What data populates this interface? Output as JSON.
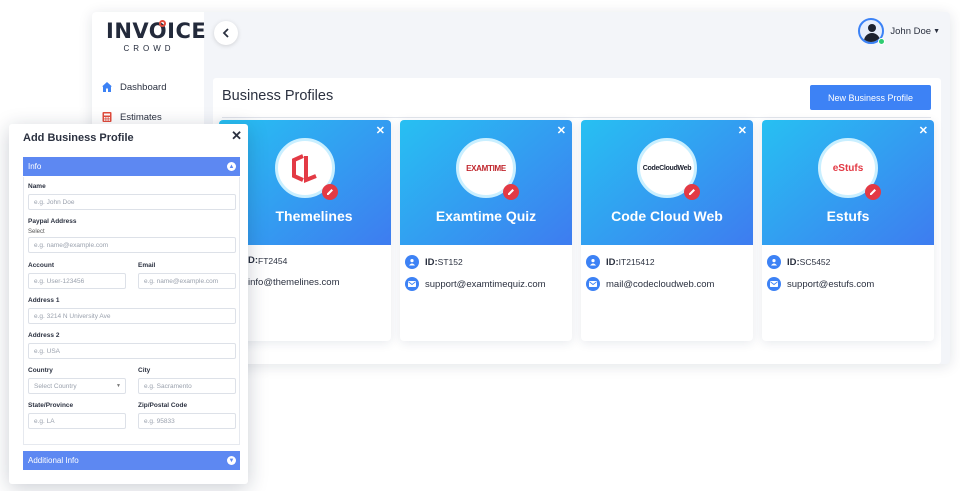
{
  "brand": {
    "name": "INVOICE",
    "sub": "CROWD"
  },
  "nav": [
    {
      "label": "Dashboard",
      "icon": "dashboard-icon"
    },
    {
      "label": "Estimates",
      "icon": "calculator-icon"
    }
  ],
  "user": {
    "name": "John Doe"
  },
  "page": {
    "title": "Business Profiles",
    "new_button": "New Business Profile"
  },
  "colors": {
    "accent": "#3d82f5",
    "edit": "#e33a45",
    "section": "#5d88f2",
    "gradient_start": "#27c0f2",
    "gradient_end": "#3e7cf0"
  },
  "cards": [
    {
      "name": "Themelines",
      "id_label": "D:",
      "id": "FT2454",
      "email": "info@themelines.com"
    },
    {
      "name": "Examtime Quiz",
      "id_label": "ID:",
      "id": "ST152",
      "email": "support@examtimequiz.com",
      "logo_text": "EXAMTIME"
    },
    {
      "name": "Code Cloud Web",
      "id_label": "ID:",
      "id": "IT215412",
      "email": "mail@codecloudweb.com",
      "logo_text": "CodeCloudWeb"
    },
    {
      "name": "Estufs",
      "id_label": "ID:",
      "id": "SC5452",
      "email": "support@estufs.com",
      "logo_text": "eStufs"
    }
  ],
  "form": {
    "title": "Add Business Profile",
    "info_section": "Info",
    "additional_section": "Additional Info",
    "name_label": "Name",
    "name_placeholder": "e.g. John Doe",
    "paypal_label": "Paypal Address",
    "paypal_sub": "Select",
    "paypal_placeholder": "e.g. name@example.com",
    "account_label": "Account",
    "account_placeholder": "e.g. User-123456",
    "email_label": "Email",
    "email_placeholder": "e.g. name@example.com",
    "address1_label": "Address 1",
    "address1_placeholder": "e.g. 3214 N University Ave",
    "address2_label": "Address 2",
    "address2_placeholder": "e.g. USA",
    "country_label": "Country",
    "country_value": "Select Country",
    "city_label": "City",
    "city_placeholder": "e.g. Sacramento",
    "state_label": "State/Province",
    "state_placeholder": "e.g. LA",
    "zip_label": "Zip/Postal Code",
    "zip_placeholder": "e.g. 95833"
  }
}
